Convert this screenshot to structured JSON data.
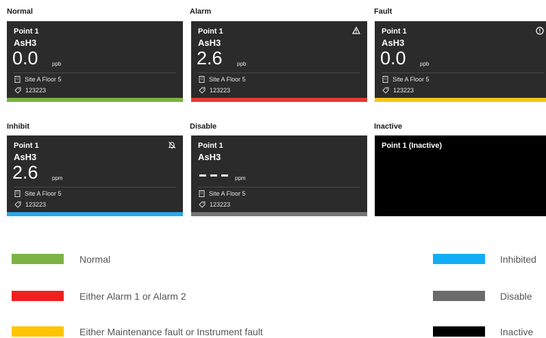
{
  "columns": [
    {
      "title": "Normal",
      "left": 0
    },
    {
      "title": "Alarm"
    },
    {
      "title": "Fault"
    },
    {
      "title": "Inhibit"
    },
    {
      "title": "Disable"
    },
    {
      "title": "Inactive"
    }
  ],
  "cards": {
    "normal": {
      "point": "Point 1",
      "gas": "AsH3",
      "value": "0.0",
      "unit": "ppb",
      "location": "Site A Floor 5",
      "tag": "123223"
    },
    "alarm": {
      "point": "Point 1",
      "gas": "AsH3",
      "value": "2.6",
      "unit": "ppb",
      "location": "Site A Floor 5",
      "tag": "123223"
    },
    "fault": {
      "point": "Point 1",
      "gas": "AsH3",
      "value": "0.0",
      "unit": "ppb",
      "location": "Site A Floor 5",
      "tag": "123223"
    },
    "inhibit": {
      "point": "Point 1",
      "gas": "AsH3",
      "value": "2.6",
      "unit": "ppm",
      "location": "Site A Floor 5",
      "tag": "123223"
    },
    "disable": {
      "point": "Point 1",
      "gas": "AsH3",
      "unit": "ppm",
      "location": "Site A Floor 5",
      "tag": "123223"
    },
    "inactive": {
      "point": "Point 1 (Inactive)"
    }
  },
  "colors": {
    "normal": "#7cb342",
    "alarm": "#e53935",
    "fault": "#f5c518",
    "inhibit": "#29a8e8",
    "disable": "#757575",
    "inactive": "#000000"
  },
  "legend": {
    "normal": "Normal",
    "alarm": "Either Alarm 1 or Alarm 2",
    "fault": "Either Maintenance fault or Instrument fault",
    "inhibit": "Inhibited",
    "disable": "Disable",
    "inactive": "Inactive"
  }
}
